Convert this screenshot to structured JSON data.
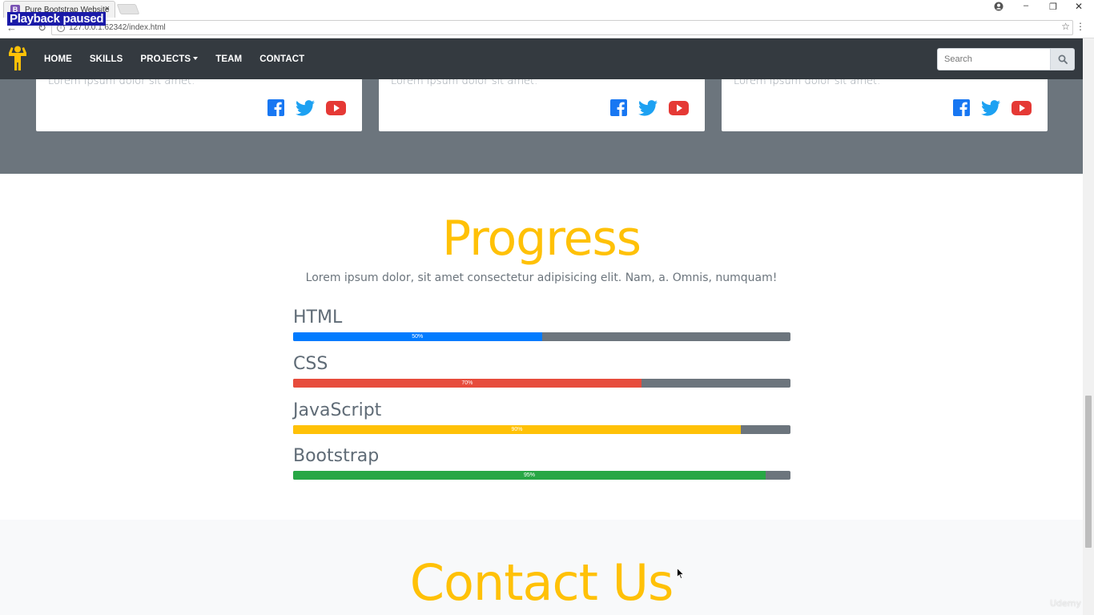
{
  "browser": {
    "overlay": "Playback paused",
    "tab_title": "Pure Bootstrap Website",
    "tab_favicon": "B",
    "tab_close": "×",
    "url": "127.0.0.1:62342/index.html"
  },
  "navbar": {
    "links": [
      "HOME",
      "SKILLS",
      "PROJECTS",
      "TEAM",
      "CONTACT"
    ],
    "search_placeholder": "Search"
  },
  "team": {
    "cards": [
      {
        "text": "Lorem ipsum dolor sit amet."
      },
      {
        "text": "Lorem ipsum dolor sit amet."
      },
      {
        "text": "Lorem ipsum dolor sit amet."
      }
    ]
  },
  "progress": {
    "title": "Progress",
    "lead": "Lorem ipsum dolor, sit amet consectetur adipisicing elit. Nam, a. Omnis, numquam!",
    "skills": [
      {
        "name": "HTML",
        "label": "50%",
        "value": 50,
        "color": "#007bff"
      },
      {
        "name": "CSS",
        "label": "70%",
        "value": 70,
        "color": "#e74c3c"
      },
      {
        "name": "JavaScript",
        "label": "90%",
        "value": 90,
        "color": "#ffc107"
      },
      {
        "name": "Bootstrap",
        "label": "95%",
        "value": 95,
        "color": "#28a745"
      }
    ]
  },
  "contact": {
    "title": "Contact Us"
  },
  "watermark": "Udemy",
  "colors": {
    "navbar": "#343a40",
    "accent": "#ffc107",
    "team_band": "#6c757d"
  }
}
